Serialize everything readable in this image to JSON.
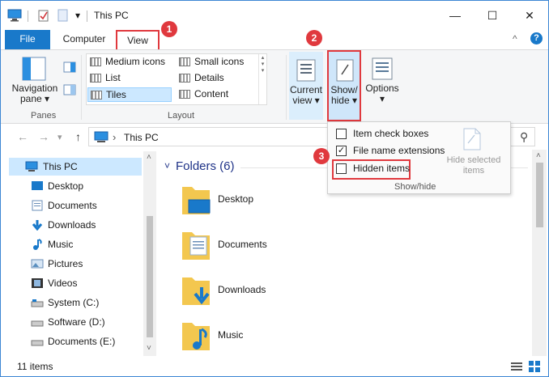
{
  "window": {
    "title": "This PC",
    "minimize_glyph": "—",
    "maximize_glyph": "☐",
    "close_glyph": "✕",
    "qat_dropdown_glyph": "▾",
    "collapse_ribbon_glyph": "^",
    "help_glyph": "?"
  },
  "tabs": {
    "file": "File",
    "computer": "Computer",
    "view": "View"
  },
  "ribbon": {
    "panes": {
      "label": "Panes",
      "nav_pane_line1": "Navigation",
      "nav_pane_line2": "pane ▾"
    },
    "layout": {
      "label": "Layout",
      "items": [
        {
          "label": "Medium icons"
        },
        {
          "label": "Small icons"
        },
        {
          "label": "List"
        },
        {
          "label": "Details"
        },
        {
          "label": "Tiles"
        },
        {
          "label": "Content"
        }
      ],
      "selected": "Tiles"
    },
    "current_view": {
      "line1": "Current",
      "line2": "view ▾"
    },
    "show_hide": {
      "line1": "Show/",
      "line2": "hide ▾"
    },
    "options": {
      "line1": "Options",
      "line2": "▾"
    }
  },
  "address": {
    "back": "←",
    "forward": "→",
    "history": "▾",
    "up": "↑",
    "separator": "›",
    "path": "This PC",
    "search_icon": "⚲"
  },
  "dropdown": {
    "item_check_boxes": {
      "label": "Item check boxes",
      "checked": false
    },
    "file_name_extensions": {
      "label": "File name extensions",
      "checked": true,
      "check_glyph": "✓"
    },
    "hidden_items": {
      "label": "Hidden items",
      "checked": false
    },
    "hide_selected_line1": "Hide selected",
    "hide_selected_line2": "items",
    "group_label": "Show/hide"
  },
  "sidebar": {
    "items": [
      {
        "label": "This PC",
        "icon": "computer-icon"
      },
      {
        "label": "Desktop",
        "icon": "desktop-icon"
      },
      {
        "label": "Documents",
        "icon": "documents-icon"
      },
      {
        "label": "Downloads",
        "icon": "downloads-icon"
      },
      {
        "label": "Music",
        "icon": "music-icon"
      },
      {
        "label": "Pictures",
        "icon": "pictures-icon"
      },
      {
        "label": "Videos",
        "icon": "videos-icon"
      },
      {
        "label": "System (C:)",
        "icon": "drive-icon"
      },
      {
        "label": "Software (D:)",
        "icon": "drive-icon"
      },
      {
        "label": "Documents (E:)",
        "icon": "drive-icon"
      }
    ],
    "scroll_up": "˄",
    "scroll_down": "˅"
  },
  "main": {
    "folders_header": "Folders (6)",
    "chevron": "˅",
    "folders": [
      {
        "label": "Desktop"
      },
      {
        "label": "Documents"
      },
      {
        "label": "Downloads"
      },
      {
        "label": "Music"
      }
    ],
    "scroll_up": "˄"
  },
  "status": {
    "count": "11 items"
  },
  "badges": {
    "one": "1",
    "two": "2",
    "three": "3"
  },
  "colors": {
    "accent": "#1979ca",
    "highlight": "#e0393e",
    "selection": "#cce8ff",
    "folder": "#f3c74f"
  }
}
